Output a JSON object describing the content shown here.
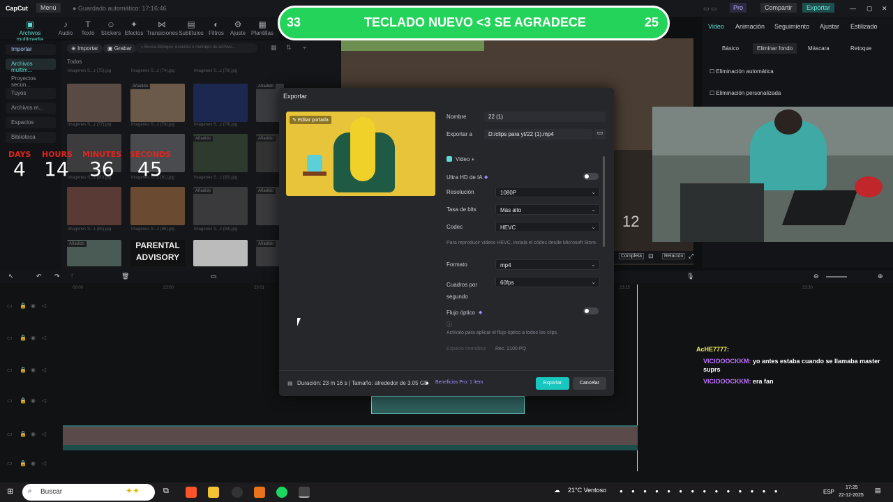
{
  "topbar": {
    "app": "CapCut",
    "menu": "Menú",
    "autosave": "Guardado automático: 17:16:46",
    "pro": "Pro",
    "share": "Compartir",
    "export": "Exportar"
  },
  "toolbar": [
    "Archivos multimedia",
    "Audio",
    "Texto",
    "Stickers",
    "Efectos",
    "Transiciones",
    "Subtítulos",
    "Filtros",
    "Ajuste",
    "Plantillas"
  ],
  "leftnav": [
    "Importar",
    "Archivos multim...",
    "Proyectos secun...",
    "Tuyos",
    "Archivos m...",
    "Espacios",
    "Biblioteca"
  ],
  "media": {
    "import": "Importar",
    "record": "Grabar",
    "search_placeholder": "Busca diálogos, escenas o metrajes de archivo...",
    "all": "Todos",
    "added": "Añadido",
    "parental1": "PARENTAL",
    "parental2": "ADVISORY",
    "labels": [
      "Imagenes S...z (75).jpg",
      "Imagenes S...z (74).jpg",
      "Imagenes S...z (76).jpg",
      "Imagenes S...z (77).jpg",
      "Imagenes S...z (78).jpg",
      "Imagenes S...z (79).jpg",
      "Imagenes S...z (80).jpg",
      "Imagenes S...z (81).jpg",
      "Imagenes S...z (82).jpg",
      "Imagenes S...z (85).jpg",
      "Imagenes S...z (86).jpg",
      "Imagenes S...z (83).jpg",
      "Imagenes S...z (84).jpg"
    ]
  },
  "banner": {
    "left": "33",
    "text": "TECLADO NUEVO <3 SE AGRADECE",
    "right": "25"
  },
  "countdown": {
    "days_label": "DAYS",
    "hours_label": "HOURS",
    "minutes_label": "MINUTES",
    "seconds_label": "SECONDS",
    "days": "4",
    "hours": "14",
    "minutes": "36",
    "seconds": "45"
  },
  "rightpanel": {
    "tabs": [
      "Video",
      "Animación",
      "Seguimiento",
      "Ajustar",
      "Estilizado"
    ],
    "subtabs": [
      "Básico",
      "Eliminar fondo",
      "Máscara",
      "Retoque"
    ],
    "auto_remove": "Eliminación automática",
    "custom_remove": "Eliminación personalizada"
  },
  "preview": {
    "complete": "Completa",
    "ratio": "Relación",
    "timer": "12"
  },
  "timeline": {
    "times": [
      "00:00",
      "23:00",
      "23:01",
      "23:15",
      "23:30"
    ]
  },
  "dialog": {
    "title": "Exportar",
    "edit_cover": "Editar portada",
    "name_label": "Nombre",
    "name_value": "22 (1)",
    "export_to_label": "Exportar a",
    "export_to_value": "D:/clips para yt/22 (1).mp4",
    "video_label": "Video",
    "uhd_label": "Ultra HD de IA",
    "resolution_label": "Resolución",
    "resolution_value": "1080P",
    "bitrate_label": "Tasa de bits",
    "bitrate_value": "Más alto",
    "codec_label": "Codec",
    "codec_value": "HEVC",
    "codec_note": "Para reproducir videos HEVC, instala el códec desde Microsoft Store.",
    "format_label": "Formato",
    "format_value": "mp4",
    "fps_label": "Cuadros por segundo",
    "fps_value": "60fps",
    "optical_label": "Flujo óptico",
    "optical_note": "Actívalo para aplicar el flujo óptico a todos los clips.",
    "colorspace_label": "Espacio cromático",
    "colorspace_value": "Rec. 2100 PQ",
    "footer_info": "Duración: 23 m 16 s | Tamaño: alrededor de 3.05 GB",
    "pro_benefits": "Beneficios Pro: 1 ítem",
    "export_btn": "Exportar",
    "cancel_btn": "Cancelar"
  },
  "chat": [
    {
      "user": "AcHE7777:",
      "msg": "",
      "color": "#f2f25a"
    },
    {
      "user": "VICIOOOCKKM:",
      "msg": "yo antes estaba cuando se llamaba master suprs",
      "color": "#c072ff"
    },
    {
      "user": "VICIOOOCKKM:",
      "msg": "era fan",
      "color": "#c072ff"
    }
  ],
  "taskbar": {
    "search": "Buscar",
    "weather": "21°C  Ventoso",
    "lang": "ESP",
    "time": "17:25",
    "date": "22-12-2025"
  }
}
